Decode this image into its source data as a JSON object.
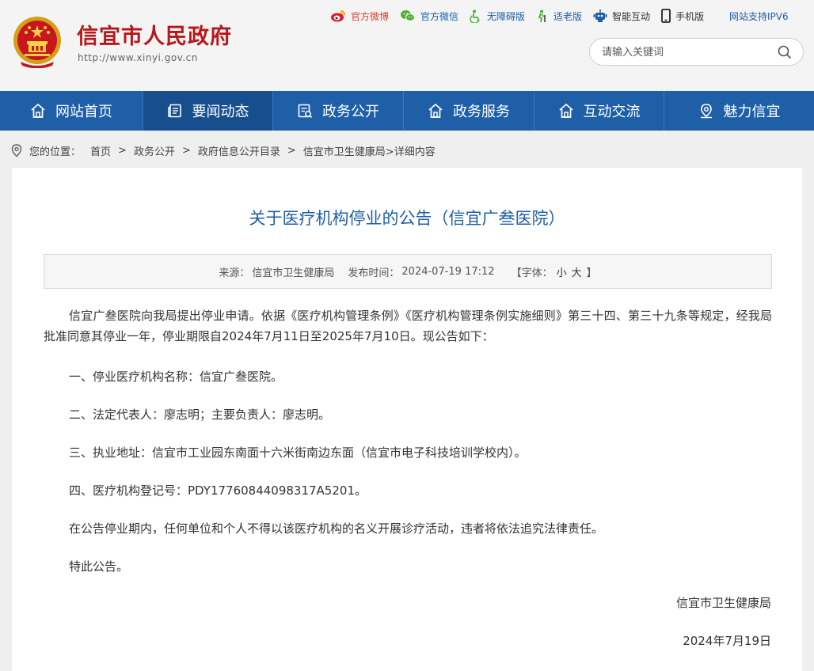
{
  "header": {
    "site_title": "信宜市人民政府",
    "site_url": "http://www.xinyi.gov.cn",
    "emblem_icon": "national-emblem-icon",
    "top_links": [
      {
        "label": "官方微博",
        "icon": "weibo-icon",
        "color": "#d9412c"
      },
      {
        "label": "官方微信",
        "icon": "wechat-icon",
        "color": "#50b133"
      },
      {
        "label": "无障碍版",
        "icon": "accessibility-icon",
        "color": "#1e5fa8"
      },
      {
        "label": "适老版",
        "icon": "elderly-icon",
        "color": "#1e5fa8"
      },
      {
        "label": "智能互动",
        "icon": "robot-icon",
        "color": "#333333"
      },
      {
        "label": "手机版",
        "icon": "mobile-icon",
        "color": "#333333"
      }
    ],
    "ipv6": "网站支持IPV6",
    "search_placeholder": "请输入关键词"
  },
  "nav": {
    "items": [
      {
        "label": "网站首页",
        "icon": "home-icon"
      },
      {
        "label": "要闻动态",
        "icon": "news-icon",
        "active": true
      },
      {
        "label": "政务公开",
        "icon": "document-icon"
      },
      {
        "label": "政务服务",
        "icon": "service-icon"
      },
      {
        "label": "互动交流",
        "icon": "interaction-icon"
      },
      {
        "label": "魅力信宜",
        "icon": "location-icon"
      }
    ]
  },
  "breadcrumb": {
    "prefix": "您的位置：",
    "items": [
      "首页",
      "政务公开",
      "政府信息公开目录",
      "信宜市卫生健康局"
    ],
    "separator": ">",
    "tail": ">详细内容"
  },
  "article": {
    "title": "关于医疗机构停业的公告（信宜广叁医院）",
    "meta": {
      "source_label": "来源：",
      "source": "信宜市卫生健康局",
      "time_label": "发布时间：",
      "time": "2024-07-19 17:12",
      "font_label": "【字体：",
      "small": "小",
      "large": "大",
      "font_end": "】"
    },
    "paragraphs": [
      "信宜广叁医院向我局提出停业申请。依据《医疗机构管理条例》《医疗机构管理条例实施细则》第三十四、第三十九条等规定，经我局批准同意其停业一年，停业期限自2024年7月11日至2025年7月10日。现公告如下：",
      "一、停业医疗机构名称：信宜广叁医院。",
      "二、法定代表人：廖志明；主要负责人：廖志明。",
      "三、执业地址：信宜市工业园东南面十六米街南边东面（信宜市电子科技培训学校内）。",
      "四、医疗机构登记号：PDY17760844098317A5201。",
      "在公告停业期内，任何单位和个人不得以该医疗机构的名义开展诊疗活动，违者将依法追究法律责任。",
      "特此公告。"
    ],
    "signature": "信宜市卫生健康局",
    "date": "2024年7月19日"
  },
  "colors": {
    "brand_red": "#b8171a",
    "nav_blue": "#1e5fa8",
    "nav_active": "#174f8e",
    "title_blue": "#1e5fa8"
  }
}
